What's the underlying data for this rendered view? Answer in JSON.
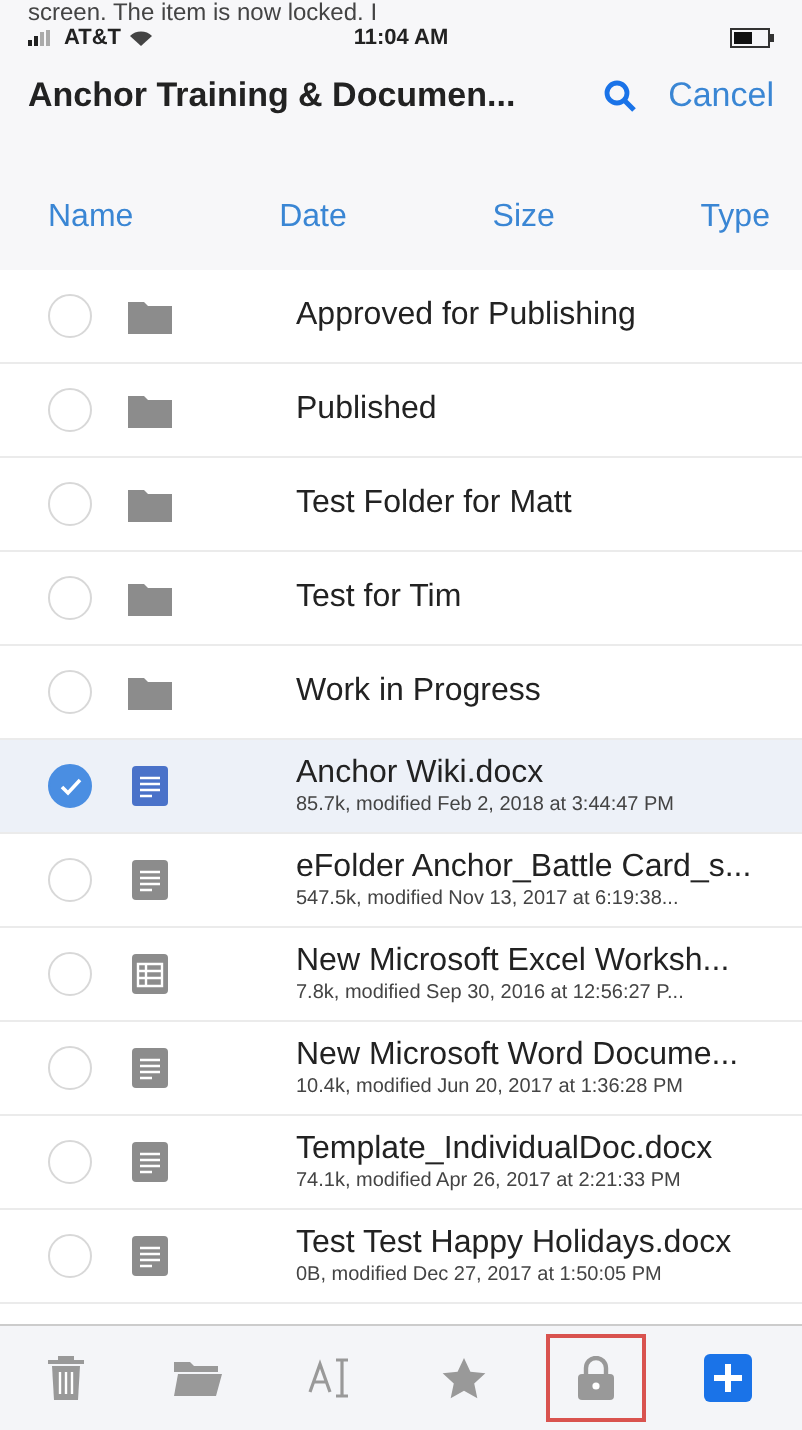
{
  "caption": "screen. The item is now locked. I",
  "status_bar": {
    "carrier": "AT&T",
    "time": "11:04 AM"
  },
  "nav": {
    "title": "Anchor Training & Documen...",
    "action": "Cancel"
  },
  "sort_columns": [
    "Name",
    "Date",
    "Size",
    "Type"
  ],
  "items": [
    {
      "kind": "folder",
      "name": "Approved for Publishing",
      "selected": false
    },
    {
      "kind": "folder",
      "name": "Published",
      "selected": false
    },
    {
      "kind": "folder",
      "name": "Test Folder for Matt",
      "selected": false
    },
    {
      "kind": "folder",
      "name": "Test for Tim",
      "selected": false
    },
    {
      "kind": "folder",
      "name": "Work in Progress",
      "selected": false
    },
    {
      "kind": "document",
      "name": "Anchor Wiki.docx",
      "detail": "85.7k, modified Feb 2, 2018 at 3:44:47 PM",
      "selected": true
    },
    {
      "kind": "document",
      "name": "eFolder Anchor_Battle Card_s...",
      "detail": "547.5k, modified Nov 13, 2017 at 6:19:38...",
      "selected": false
    },
    {
      "kind": "spreadsheet",
      "name": "New Microsoft Excel Worksh...",
      "detail": "7.8k, modified Sep 30, 2016 at 12:56:27 P...",
      "selected": false
    },
    {
      "kind": "document",
      "name": "New Microsoft Word Docume...",
      "detail": "10.4k, modified Jun 20, 2017 at 1:36:28 PM",
      "selected": false
    },
    {
      "kind": "document",
      "name": "Template_IndividualDoc.docx",
      "detail": "74.1k, modified Apr 26, 2017 at 2:21:33 PM",
      "selected": false
    },
    {
      "kind": "document",
      "name": "Test Test Happy Holidays.docx",
      "detail": "0B, modified Dec 27, 2017 at 1:50:05 PM",
      "selected": false
    }
  ],
  "toolbar": [
    {
      "kind": "trash",
      "highlighted": false
    },
    {
      "kind": "folder",
      "highlighted": false
    },
    {
      "kind": "rename",
      "highlighted": false
    },
    {
      "kind": "star",
      "highlighted": false
    },
    {
      "kind": "lock",
      "highlighted": true
    },
    {
      "kind": "add",
      "highlighted": false
    }
  ]
}
